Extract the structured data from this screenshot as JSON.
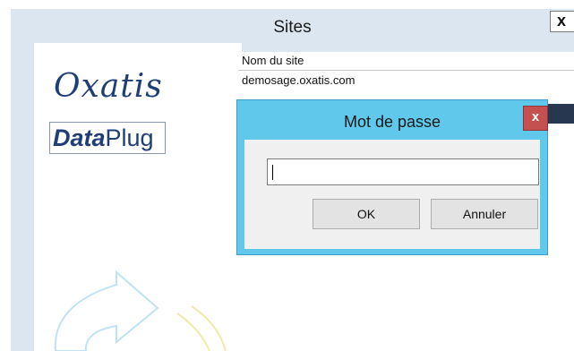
{
  "parent_window": {
    "title": "Sites",
    "close_glyph": "x"
  },
  "logo": {
    "brand": "Oxatis",
    "product_bold": "Data",
    "product_rest": "Plug"
  },
  "site_list": {
    "column_header": "Nom du site",
    "rows": [
      "demosage.oxatis.com"
    ]
  },
  "dialog": {
    "title": "Mot de passe",
    "close_glyph": "x",
    "password_value": "",
    "ok_label": "OK",
    "cancel_label": "Annuler"
  },
  "colors": {
    "dialog_frame": "#60c8eb",
    "dialog_close": "#c4514f",
    "parent_chrome": "#dbe6f0",
    "logo_blue": "#1f3d77"
  },
  "icons": [
    "close-icon",
    "refresh-arrow-icon"
  ]
}
